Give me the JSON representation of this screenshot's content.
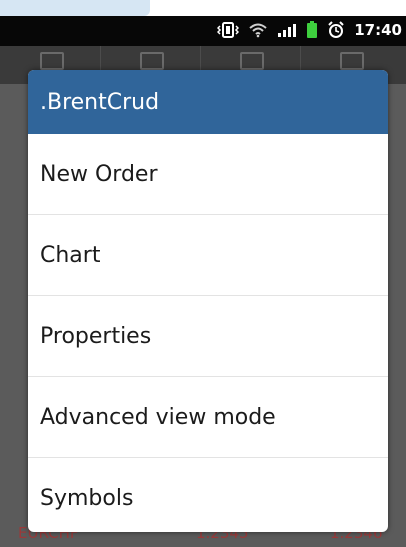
{
  "status_bar": {
    "time": "17:40",
    "icons": [
      "vibrate-icon",
      "wifi-icon",
      "signal-icon",
      "battery-icon",
      "alarm-icon"
    ]
  },
  "dialog": {
    "title": ".BrentCrud",
    "items": [
      {
        "label": "New Order"
      },
      {
        "label": "Chart"
      },
      {
        "label": "Properties"
      },
      {
        "label": "Advanced view mode"
      },
      {
        "label": "Symbols"
      }
    ]
  },
  "background_row": {
    "symbol": "EURCHF",
    "bid": "1.2345",
    "ask": "1.2346"
  },
  "colors": {
    "title_bar": "#30659a",
    "status_bar": "#070707",
    "battery": "#3ecf3e"
  }
}
